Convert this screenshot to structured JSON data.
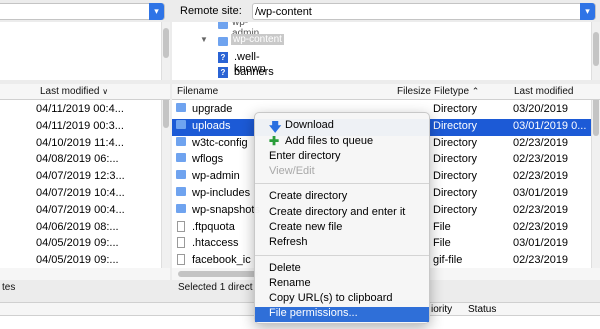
{
  "remote_site": {
    "label": "Remote site:",
    "path": "/wp-content"
  },
  "remote_tree": {
    "items": [
      {
        "label": "wp-admin",
        "has_chevron": false
      },
      {
        "label": "wp-content",
        "has_chevron": true
      },
      {
        "label": ".well-known",
        "has_chevron": false
      },
      {
        "label": "banners",
        "has_chevron": false
      }
    ]
  },
  "local_header": {
    "last_modified": "Last modified"
  },
  "local_rows": [
    "04/11/2019 00:4...",
    "04/11/2019 00:3...",
    "04/10/2019 11:4...",
    "04/08/2019 06:...",
    "04/07/2019 12:3...",
    "04/07/2019 10:4...",
    "04/07/2019 00:4...",
    "04/06/2019 08:...",
    "04/05/2019 09:...",
    "04/05/2019 09:..."
  ],
  "local_status": "tes",
  "remote_header": {
    "filename": "Filename",
    "filesize": "Filesize",
    "filetype": "Filetype",
    "last_modified": "Last modified"
  },
  "remote_rows": [
    {
      "name": "upgrade",
      "type": "Directory",
      "modified": "03/20/2019",
      "icon": "folder-icon"
    },
    {
      "name": "uploads",
      "type": "Directory",
      "modified": "03/01/2019 0...",
      "icon": "folder-icon"
    },
    {
      "name": "w3tc-config",
      "type": "Directory",
      "modified": "02/23/2019",
      "icon": "folder-icon"
    },
    {
      "name": "wflogs",
      "type": "Directory",
      "modified": "02/23/2019",
      "icon": "folder-icon"
    },
    {
      "name": "wp-admin",
      "type": "Directory",
      "modified": "02/23/2019",
      "icon": "folder-icon"
    },
    {
      "name": "wp-includes",
      "type": "Directory",
      "modified": "03/01/2019",
      "icon": "folder-icon"
    },
    {
      "name": "wp-snapshots",
      "type": "Directory",
      "modified": "02/23/2019",
      "icon": "folder-icon"
    },
    {
      "name": ".ftpquota",
      "type": "File",
      "modified": "02/23/2019",
      "icon": "file-icon"
    },
    {
      "name": ".htaccess",
      "type": "File",
      "modified": "03/01/2019",
      "icon": "file-icon"
    },
    {
      "name": "facebook_ic",
      "type": "gif-file",
      "modified": "02/23/2019",
      "icon": "file-icon"
    }
  ],
  "remote_status": "Selected 1 direct",
  "queue_header": {
    "priority": "iority",
    "status": "Status"
  },
  "context_menu": {
    "download": "Download",
    "add_to_queue": "Add files to queue",
    "enter_directory": "Enter directory",
    "view_edit": "View/Edit",
    "create_directory": "Create directory",
    "create_directory_enter": "Create directory and enter it",
    "create_new_file": "Create new file",
    "refresh": "Refresh",
    "delete": "Delete",
    "rename": "Rename",
    "copy_urls": "Copy URL(s) to clipboard",
    "file_permissions": "File permissions..."
  }
}
